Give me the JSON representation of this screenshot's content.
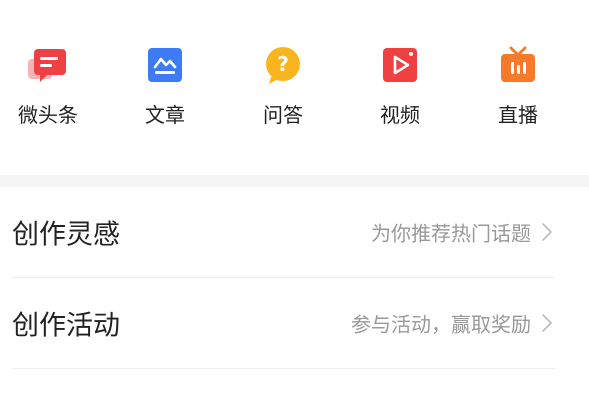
{
  "publish": {
    "items": [
      {
        "label": "微头条",
        "icon": "micro-headline-icon",
        "color": "#F04142"
      },
      {
        "label": "文章",
        "icon": "article-icon",
        "color": "#3E7BF6"
      },
      {
        "label": "问答",
        "icon": "qa-icon",
        "color": "#F9B51E"
      },
      {
        "label": "视频",
        "icon": "video-icon",
        "color": "#F04142"
      },
      {
        "label": "直播",
        "icon": "live-icon",
        "color": "#F57A2A"
      }
    ]
  },
  "list": {
    "rows": [
      {
        "title": "创作灵感",
        "hint": "为你推荐热门话题"
      },
      {
        "title": "创作活动",
        "hint": "参与活动，赢取奖励"
      }
    ]
  }
}
